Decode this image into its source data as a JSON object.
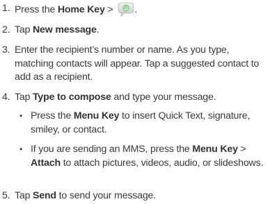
{
  "steps": [
    {
      "num": "1.",
      "parts": [
        "Press the ",
        "Home Key",
        " > ",
        "."
      ],
      "icon": "messaging-app-icon"
    },
    {
      "num": "2.",
      "parts": [
        "Tap ",
        "New message",
        "."
      ]
    },
    {
      "num": "3.",
      "text": "Enter the recipient’s number or name. As you type, matching contacts will appear. Tap a suggested contact to add as a recipient."
    },
    {
      "num": "4.",
      "parts": [
        "Tap ",
        "Type to compose",
        " and type your message."
      ]
    },
    {
      "num": "5.",
      "parts": [
        "Tap ",
        "Send",
        " to send your message."
      ]
    }
  ],
  "bullets": [
    {
      "symbol": "•",
      "parts": [
        "Press the ",
        "Menu Key",
        " to insert Quick Text, signature, smiley, or contact."
      ]
    },
    {
      "symbol": "•",
      "parts": [
        "If you are sending an MMS, press the ",
        "Menu Key",
        " > ",
        "Attach",
        " to attach pictures, videos, audio, or slideshows."
      ]
    }
  ],
  "colors": {
    "text": "#3a3a3a",
    "icon_bubble": "#d8d8d8",
    "icon_face": "#8fd18a"
  }
}
